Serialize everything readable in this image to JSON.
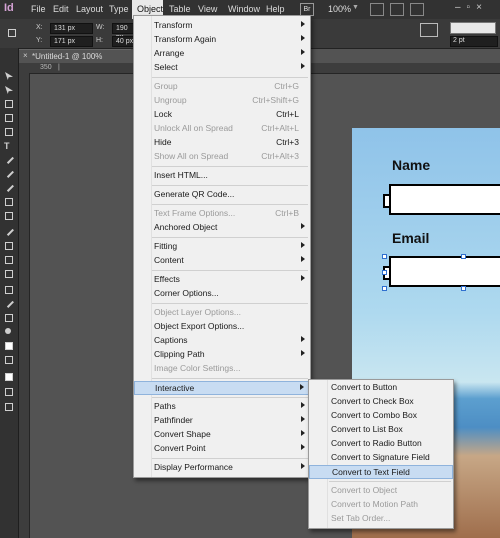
{
  "app": {
    "logo": "Id"
  },
  "menubar": {
    "items": [
      "File",
      "Edit",
      "Layout",
      "Type",
      "Object",
      "Table",
      "View",
      "Window",
      "Help"
    ],
    "badge": "Br",
    "zoom": "100%"
  },
  "controlbar": {
    "x_label": "X:",
    "x_value": "131 px",
    "y_label": "Y:",
    "y_value": "171 px",
    "w_label": "W:",
    "w_value": "190 px",
    "h_label": "H:",
    "h_value": "40 px",
    "stroke_weight": "2 pt"
  },
  "document": {
    "tab_title": "*Untitled-1 @ 100%",
    "ruler_marks": [
      "350",
      "|"
    ]
  },
  "form": {
    "name_label": "Name",
    "email_label": "Email"
  },
  "object_menu": [
    {
      "label": "Transform",
      "submenu": true
    },
    {
      "label": "Transform Again",
      "submenu": true
    },
    {
      "label": "Arrange",
      "submenu": true
    },
    {
      "label": "Select",
      "submenu": true
    },
    {
      "label": "Group",
      "shortcut": "Ctrl+G",
      "disabled": true
    },
    {
      "label": "Ungroup",
      "shortcut": "Ctrl+Shift+G",
      "disabled": true
    },
    {
      "label": "Lock",
      "shortcut": "Ctrl+L"
    },
    {
      "label": "Unlock All on Spread",
      "shortcut": "Ctrl+Alt+L",
      "disabled": true
    },
    {
      "label": "Hide",
      "shortcut": "Ctrl+3"
    },
    {
      "label": "Show All on Spread",
      "shortcut": "Ctrl+Alt+3",
      "disabled": true
    },
    {
      "label": "Insert HTML..."
    },
    {
      "label": "Generate QR Code..."
    },
    {
      "label": "Text Frame Options...",
      "shortcut": "Ctrl+B",
      "disabled": true
    },
    {
      "label": "Anchored Object",
      "submenu": true
    },
    {
      "label": "Fitting",
      "submenu": true
    },
    {
      "label": "Content",
      "submenu": true
    },
    {
      "label": "Effects",
      "submenu": true
    },
    {
      "label": "Corner Options..."
    },
    {
      "label": "Object Layer Options...",
      "disabled": true
    },
    {
      "label": "Object Export Options..."
    },
    {
      "label": "Captions",
      "submenu": true
    },
    {
      "label": "Clipping Path",
      "submenu": true
    },
    {
      "label": "Image Color Settings...",
      "disabled": true
    },
    {
      "label": "Interactive",
      "submenu": true,
      "highlighted": true
    },
    {
      "label": "Paths",
      "submenu": true
    },
    {
      "label": "Pathfinder",
      "submenu": true
    },
    {
      "label": "Convert Shape",
      "submenu": true
    },
    {
      "label": "Convert Point",
      "submenu": true
    },
    {
      "label": "Display Performance",
      "submenu": true
    }
  ],
  "interactive_submenu": [
    {
      "label": "Convert to Button"
    },
    {
      "label": "Convert to Check Box"
    },
    {
      "label": "Convert to Combo Box"
    },
    {
      "label": "Convert to List Box"
    },
    {
      "label": "Convert to Radio Button"
    },
    {
      "label": "Convert to Signature Field"
    },
    {
      "label": "Convert to Text Field",
      "highlighted": true
    },
    {
      "label": "Convert to Object",
      "disabled": true
    },
    {
      "label": "Convert to Motion Path",
      "disabled": true
    },
    {
      "label": "Set Tab Order...",
      "disabled": true
    }
  ]
}
